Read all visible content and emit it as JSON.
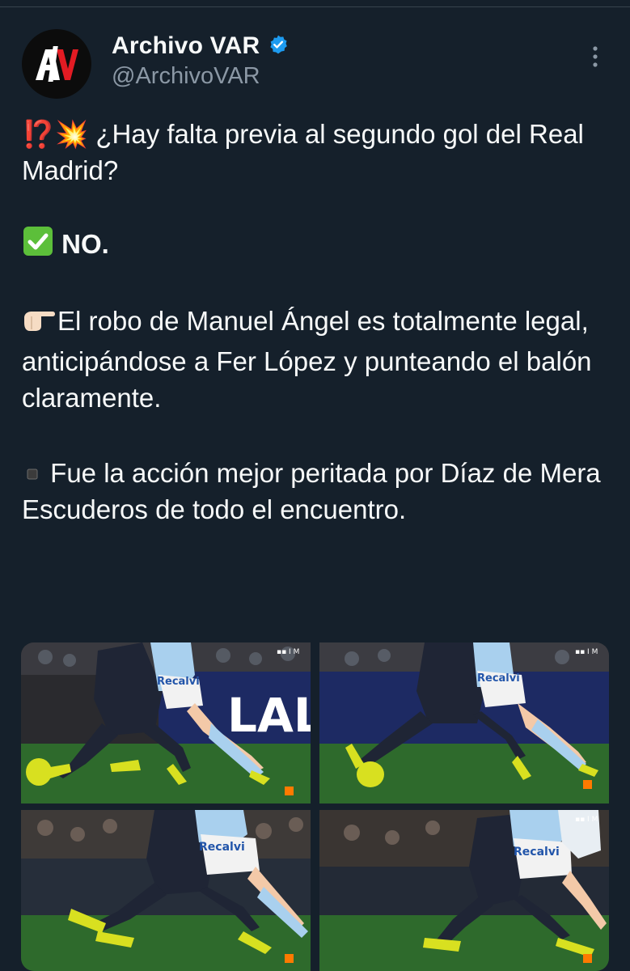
{
  "author": {
    "display_name": "Archivo VAR",
    "handle": "@ArchivoVAR",
    "verified": true,
    "avatar_text": "AV",
    "avatar_icon": "archivo-var-logo"
  },
  "menu": {
    "more_icon": "more-vertical-icon"
  },
  "tweet": {
    "line1_emojis": "⁉️💥",
    "line1": " ¿Hay falta previa al segundo gol del Real Madrid?",
    "line2_emoji": "✅",
    "line2": " NO.",
    "line3_emoji": "👉🏻",
    "line3": "El robo de Manuel Ángel es totalmente legal, anticipándose a Fer López y punteando el balón claramente.",
    "line4_emoji": "◾",
    "line4": "  Fue la acción mejor peritada por Díaz de Mera Escuderos de todo el encuentro."
  },
  "media": {
    "count": 4,
    "images": [
      {
        "alt": "football-action-frame-1",
        "board_text": "LALIG",
        "sponsor_text": "Recalvi"
      },
      {
        "alt": "football-action-frame-2",
        "board_text": "",
        "sponsor_text": "Recalvi"
      },
      {
        "alt": "football-action-frame-3",
        "board_text": "",
        "sponsor_text": "Recalvi"
      },
      {
        "alt": "football-action-frame-4",
        "board_text": "",
        "sponsor_text": "Recalvi"
      }
    ],
    "colors": {
      "pitch": "#2e6a2c",
      "crowd": "#2a2a2e",
      "navy_kit": "#1f2535",
      "sky_kit": "#a9d0ee",
      "boot": "#d8e020",
      "broadcaster_badge": "#ff7a00"
    }
  },
  "theme": {
    "background": "#15202b",
    "text": "#f7f9f9",
    "muted": "#8b98a5",
    "verified_blue": "#1d9bf0"
  }
}
